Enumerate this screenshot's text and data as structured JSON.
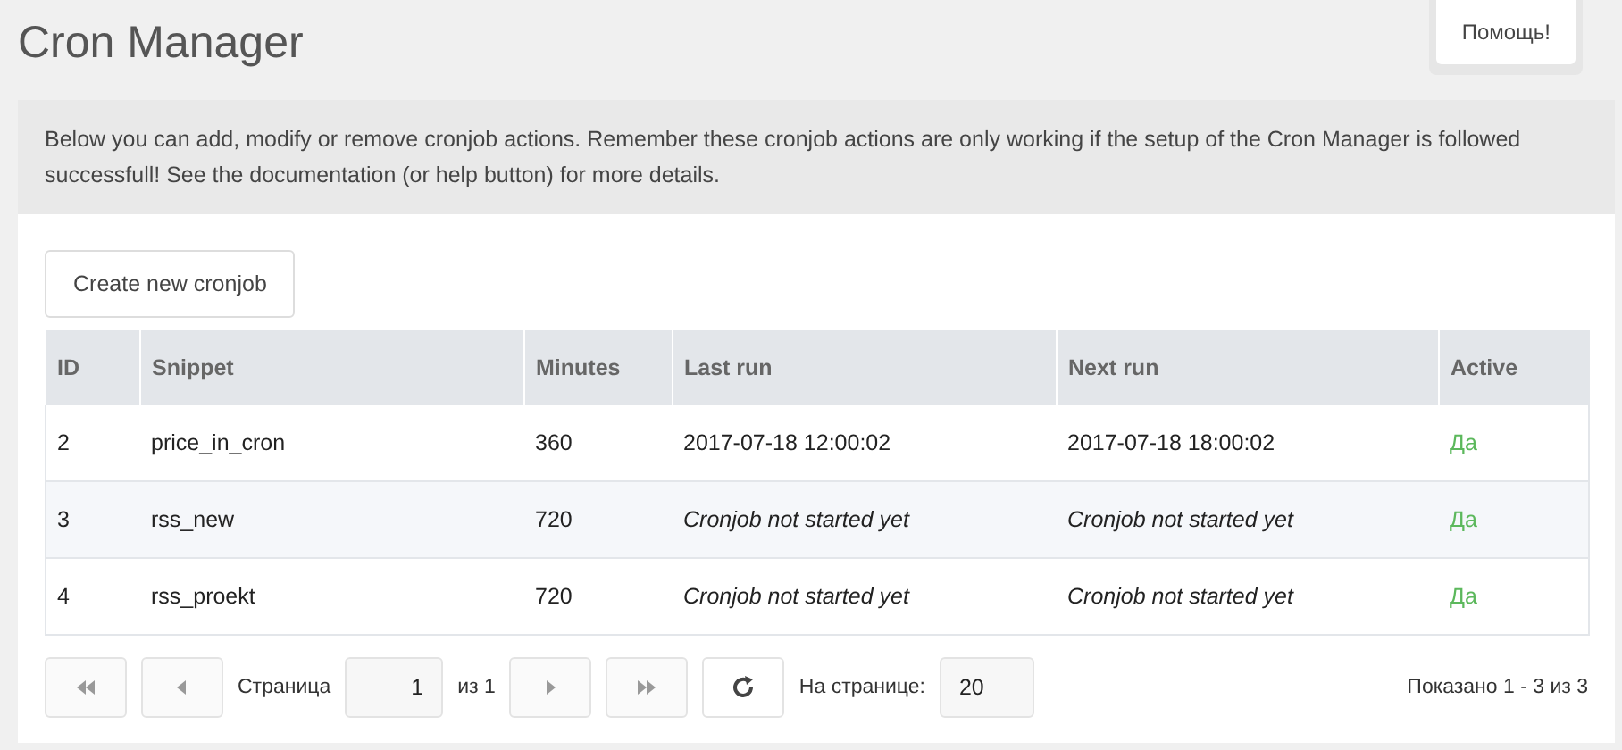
{
  "title": "Cron Manager",
  "help_button": "Помощь!",
  "info": "Below you can add, modify or remove cronjob actions. Remember these cronjob actions are only working if the setup of the Cron Manager is followed successfull! See the documentation (or help button) for more details.",
  "create_button": "Create new cronjob",
  "table": {
    "columns": [
      "ID",
      "Snippet",
      "Minutes",
      "Last run",
      "Next run",
      "Active"
    ],
    "rows": [
      {
        "id": "2",
        "snippet": "price_in_cron",
        "minutes": "360",
        "last_run": "2017-07-18 12:00:02",
        "next_run": "2017-07-18 18:00:02",
        "started": true,
        "active": "Да",
        "is_active": true
      },
      {
        "id": "3",
        "snippet": "rss_new",
        "minutes": "720",
        "last_run": "Cronjob not started yet",
        "next_run": "Cronjob not started yet",
        "started": false,
        "active": "Да",
        "is_active": true
      },
      {
        "id": "4",
        "snippet": "rss_proekt",
        "minutes": "720",
        "last_run": "Cronjob not started yet",
        "next_run": "Cronjob not started yet",
        "started": false,
        "active": "Да",
        "is_active": true
      }
    ]
  },
  "pager": {
    "first_disabled": true,
    "prev_disabled": true,
    "page_label": "Страница",
    "page": "1",
    "of_label": "из 1",
    "next_disabled": true,
    "last_disabled": true,
    "per_page_label": "На странице:",
    "per_page": "20",
    "summary": "Показано 1 - 3 из 3"
  }
}
